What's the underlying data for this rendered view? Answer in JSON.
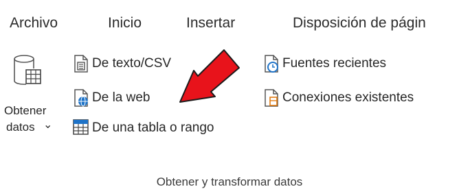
{
  "tabs": [
    {
      "label": "Archivo"
    },
    {
      "label": "Inicio"
    },
    {
      "label": "Insertar"
    },
    {
      "label": "Disposición de págin"
    }
  ],
  "ribbon": {
    "get_data": {
      "line1": "Obtener",
      "line2": "datos",
      "chevron": "⌄",
      "icon": "database-table-icon"
    },
    "items_left": [
      {
        "label": "De texto/CSV",
        "icon": "text-file-icon"
      },
      {
        "label": "De la web",
        "icon": "web-page-icon"
      },
      {
        "label": "De una tabla o rango",
        "icon": "table-range-icon"
      }
    ],
    "items_right": [
      {
        "label": "Fuentes recientes",
        "icon": "recent-sources-icon"
      },
      {
        "label": "Conexiones existentes",
        "icon": "existing-connections-icon"
      }
    ],
    "group_label": "Obtener y transformar datos"
  },
  "annotation": {
    "icon": "red-arrow-icon",
    "color": "#e8131b",
    "points_to": "De la web"
  }
}
